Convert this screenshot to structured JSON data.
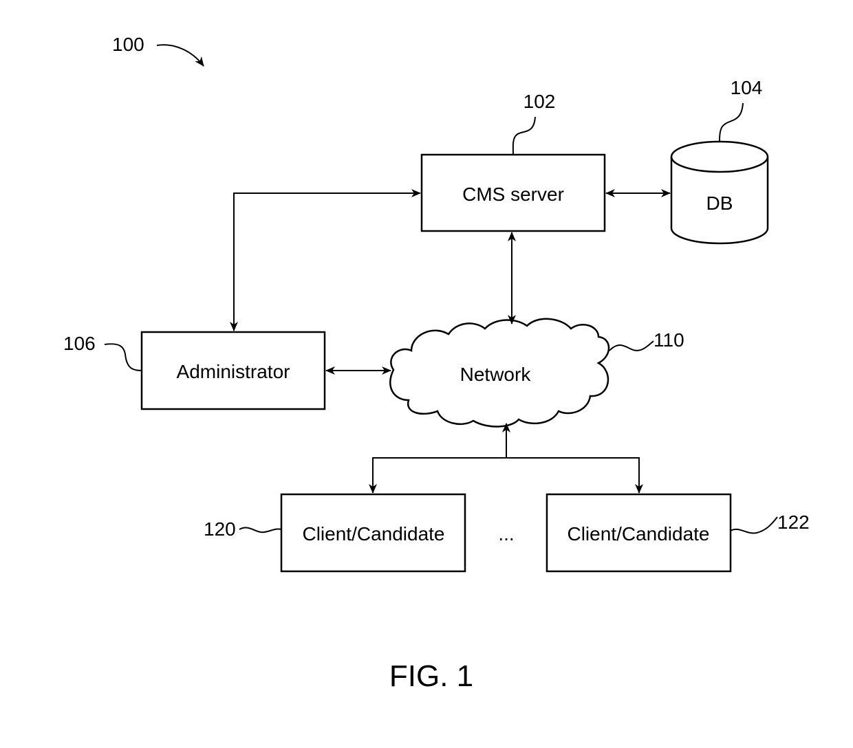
{
  "figure": {
    "caption": "FIG. 1",
    "system_ref": "100"
  },
  "nodes": {
    "cms_server": {
      "label": "CMS server",
      "ref": "102"
    },
    "db": {
      "label": "DB",
      "ref": "104"
    },
    "administrator": {
      "label": "Administrator",
      "ref": "106"
    },
    "network": {
      "label": "Network",
      "ref": "110"
    },
    "client_1": {
      "label": "Client/Candidate",
      "ref": "120"
    },
    "client_n": {
      "label": "Client/Candidate",
      "ref": "122"
    },
    "ellipsis": "..."
  },
  "edges": [
    {
      "from": "administrator",
      "to": "cms_server",
      "direction": "bidirectional"
    },
    {
      "from": "cms_server",
      "to": "db",
      "direction": "bidirectional"
    },
    {
      "from": "cms_server",
      "to": "network",
      "direction": "bidirectional"
    },
    {
      "from": "administrator",
      "to": "network",
      "direction": "bidirectional"
    },
    {
      "from": "network",
      "to": "client_1",
      "direction": "bidirectional"
    },
    {
      "from": "network",
      "to": "client_n",
      "direction": "bidirectional"
    }
  ]
}
